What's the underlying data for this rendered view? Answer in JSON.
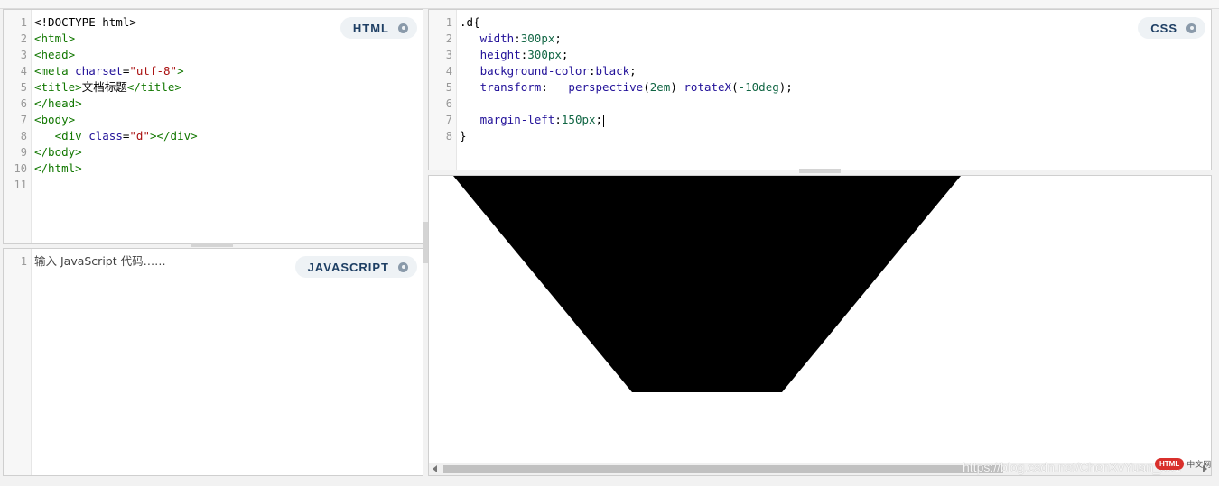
{
  "editors": {
    "html": {
      "badge": "HTML",
      "lines": [
        [
          {
            "t": "<!DOCTYPE html>",
            "c": "plain"
          }
        ],
        [
          {
            "t": "<html>",
            "c": "tag"
          }
        ],
        [
          {
            "t": "<head>",
            "c": "tag"
          }
        ],
        [
          {
            "t": "<meta ",
            "c": "tag"
          },
          {
            "t": "charset",
            "c": "attr"
          },
          {
            "t": "=",
            "c": "plain"
          },
          {
            "t": "\"utf-8\"",
            "c": "str"
          },
          {
            "t": ">",
            "c": "tag"
          }
        ],
        [
          {
            "t": "<title>",
            "c": "tag"
          },
          {
            "t": "文档标题",
            "c": "plain"
          },
          {
            "t": "</title>",
            "c": "tag"
          }
        ],
        [
          {
            "t": "</head>",
            "c": "tag"
          }
        ],
        [
          {
            "t": "<body>",
            "c": "tag"
          }
        ],
        [
          {
            "t": "   ",
            "c": "plain"
          },
          {
            "t": "<div ",
            "c": "tag"
          },
          {
            "t": "class",
            "c": "attr"
          },
          {
            "t": "=",
            "c": "plain"
          },
          {
            "t": "\"d\"",
            "c": "str"
          },
          {
            "t": "></div>",
            "c": "tag"
          }
        ],
        [
          {
            "t": "</body>",
            "c": "tag"
          }
        ],
        [
          {
            "t": "</html>",
            "c": "tag"
          }
        ],
        []
      ]
    },
    "css": {
      "badge": "CSS",
      "lines": [
        [
          {
            "t": ".d{",
            "c": "plain"
          }
        ],
        [
          {
            "t": "   ",
            "c": "plain"
          },
          {
            "t": "width",
            "c": "prop"
          },
          {
            "t": ":",
            "c": "plain"
          },
          {
            "t": "300px",
            "c": "num"
          },
          {
            "t": ";",
            "c": "plain"
          }
        ],
        [
          {
            "t": "   ",
            "c": "plain"
          },
          {
            "t": "height",
            "c": "prop"
          },
          {
            "t": ":",
            "c": "plain"
          },
          {
            "t": "300px",
            "c": "num"
          },
          {
            "t": ";",
            "c": "plain"
          }
        ],
        [
          {
            "t": "   ",
            "c": "plain"
          },
          {
            "t": "background-color",
            "c": "prop"
          },
          {
            "t": ":",
            "c": "plain"
          },
          {
            "t": "black",
            "c": "attr"
          },
          {
            "t": ";",
            "c": "plain"
          }
        ],
        [
          {
            "t": "   ",
            "c": "plain"
          },
          {
            "t": "transform",
            "c": "prop"
          },
          {
            "t": ":   ",
            "c": "plain"
          },
          {
            "t": "perspective",
            "c": "attr"
          },
          {
            "t": "(",
            "c": "plain"
          },
          {
            "t": "2em",
            "c": "num"
          },
          {
            "t": ") ",
            "c": "plain"
          },
          {
            "t": "rotateX",
            "c": "attr"
          },
          {
            "t": "(",
            "c": "plain"
          },
          {
            "t": "-10deg",
            "c": "num"
          },
          {
            "t": ");",
            "c": "plain"
          }
        ],
        [],
        [
          {
            "t": "   ",
            "c": "plain"
          },
          {
            "t": "margin-left",
            "c": "prop"
          },
          {
            "t": ":",
            "c": "plain"
          },
          {
            "t": "150px",
            "c": "num"
          },
          {
            "t": ";",
            "c": "plain"
          }
        ],
        [
          {
            "t": "}",
            "c": "plain"
          }
        ]
      ]
    },
    "javascript": {
      "badge": "JAVASCRIPT",
      "lines": [
        [
          {
            "t": "输入 JavaScript 代码……",
            "c": "ph"
          }
        ]
      ]
    }
  },
  "result": {
    "shape_color": "#000000"
  },
  "watermark": "https://blog.csdn.net/ChenXvYuan_001",
  "logo": {
    "badge": "HTML",
    "text": "中文网"
  }
}
